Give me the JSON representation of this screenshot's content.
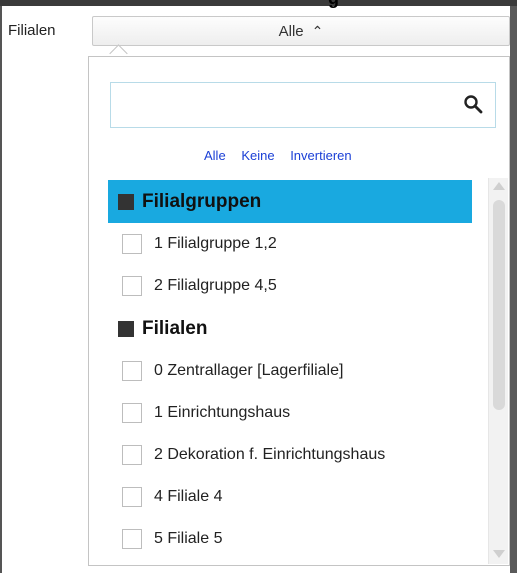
{
  "header": {
    "title_fragment": "g"
  },
  "filter": {
    "label": "Filialen",
    "selected_value": "Alle",
    "chevron": "chevron-up-icon"
  },
  "search": {
    "value": "",
    "placeholder": ""
  },
  "actions": {
    "all": "Alle",
    "none": "Keine",
    "invert": "Invertieren"
  },
  "list": {
    "groups": [
      {
        "title": "Filialgruppen",
        "selected": true,
        "items": [
          "1 Filialgruppe 1,2",
          "2 Filialgruppe 4,5"
        ]
      },
      {
        "title": "Filialen",
        "selected": false,
        "items": [
          "0 Zentrallager [Lagerfiliale]",
          "1 Einrichtungshaus",
          "2 Dekoration f. Einrichtungshaus",
          "4 Filiale 4",
          "5 Filiale 5"
        ]
      }
    ]
  },
  "colors": {
    "selected_header": "#19a9e0",
    "link": "#1a3fd6",
    "search_border": "#b8dbe8"
  }
}
